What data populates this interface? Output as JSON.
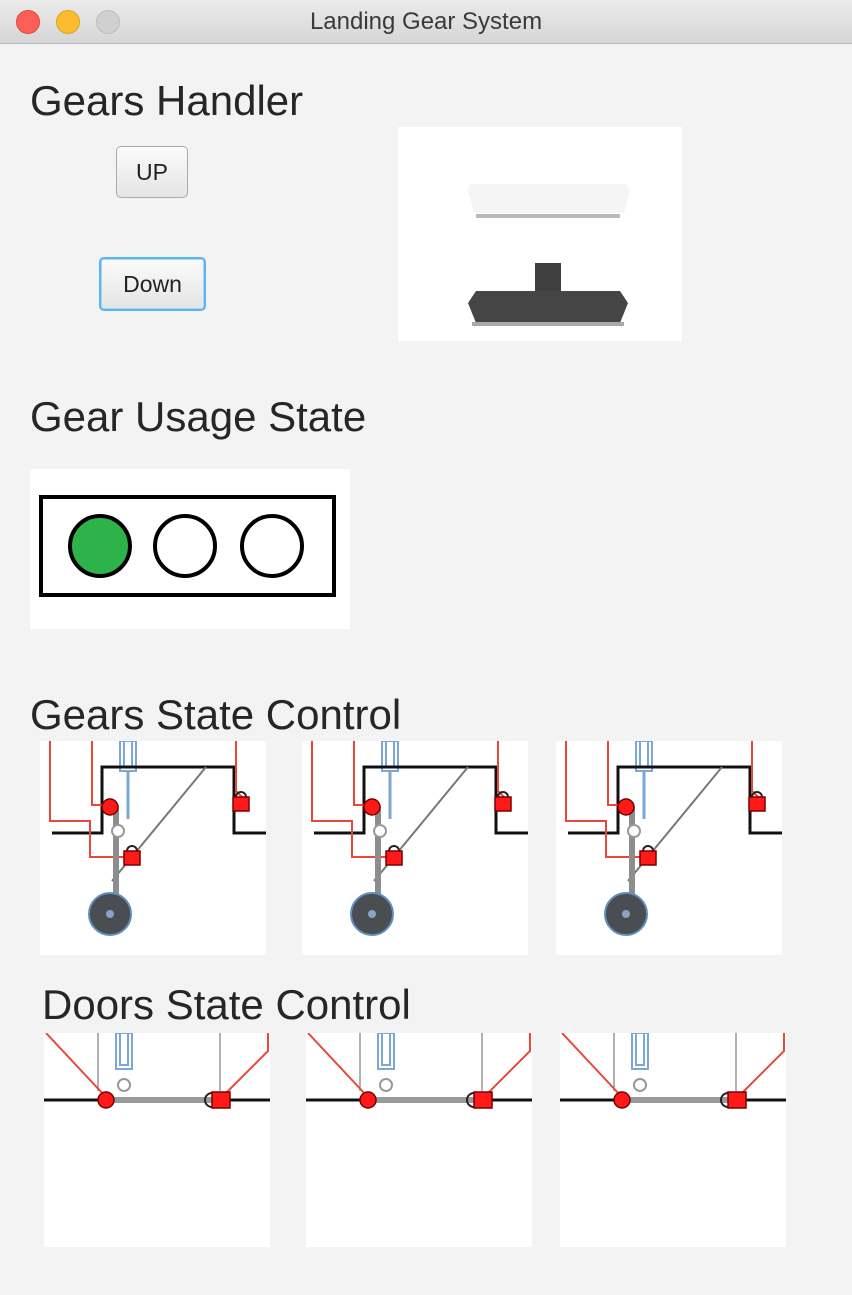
{
  "window": {
    "title": "Landing Gear System"
  },
  "sections": {
    "gears_handler": "Gears Handler",
    "gear_usage_state": "Gear Usage State",
    "gears_state_control": "Gears State Control",
    "doors_state_control": "Doors State Control"
  },
  "buttons": {
    "up": "UP",
    "down": "Down"
  },
  "handle_icon": "landing-gear-handle-down-icon",
  "usage_lights": {
    "active_index": 0,
    "active_color": "#2db34a",
    "count": 3
  },
  "gears": [
    {
      "name": "front-gear",
      "icon": "landing-gear-diagram-icon"
    },
    {
      "name": "left-gear",
      "icon": "landing-gear-diagram-icon"
    },
    {
      "name": "right-gear",
      "icon": "landing-gear-diagram-icon"
    }
  ],
  "doors": [
    {
      "name": "front-door",
      "icon": "gear-door-diagram-icon"
    },
    {
      "name": "left-door",
      "icon": "gear-door-diagram-icon"
    },
    {
      "name": "right-door",
      "icon": "gear-door-diagram-icon"
    }
  ],
  "colors": {
    "lock_red": "#ff1a1a",
    "wire_red": "#e8473a",
    "piston_blue": "#7aa7d6"
  }
}
